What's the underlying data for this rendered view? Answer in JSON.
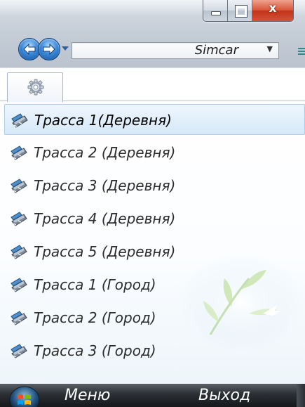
{
  "window": {
    "minimize_icon": "minimize-icon",
    "maximize_icon": "maximize-icon",
    "close_icon": "close-icon",
    "close_glyph": "x",
    "close_color": "#d9553b"
  },
  "navigation": {
    "back_icon": "back-arrow-icon",
    "forward_icon": "forward-arrow-icon",
    "history_icon": "chevron-down-icon",
    "address_value": "Simcar",
    "address_dropdown_glyph": "▼"
  },
  "tabs": [
    {
      "icon": "gear-icon",
      "selected": true
    }
  ],
  "list": {
    "item_icon": "track-icon",
    "selected_index": 0,
    "items": [
      {
        "label": "Трасса 1(Деревня)"
      },
      {
        "label": "Трасса 2 (Деревня)"
      },
      {
        "label": "Трасса 3 (Деревня)"
      },
      {
        "label": "Трасса 4 (Деревня)"
      },
      {
        "label": "Трасса 5 (Деревня)"
      },
      {
        "label": "Трасса 1 (Город)"
      },
      {
        "label": "Трасса 2 (Город)"
      },
      {
        "label": "Трасса 3 (Город)"
      }
    ]
  },
  "softkeys": {
    "start_icon": "windows-start-icon",
    "left_label": "Меню",
    "right_label": "Выход"
  },
  "colors": {
    "selection": "#d6e8f8",
    "softkey_bar": "#2b2f34",
    "titlebar": "#cfd6de"
  }
}
